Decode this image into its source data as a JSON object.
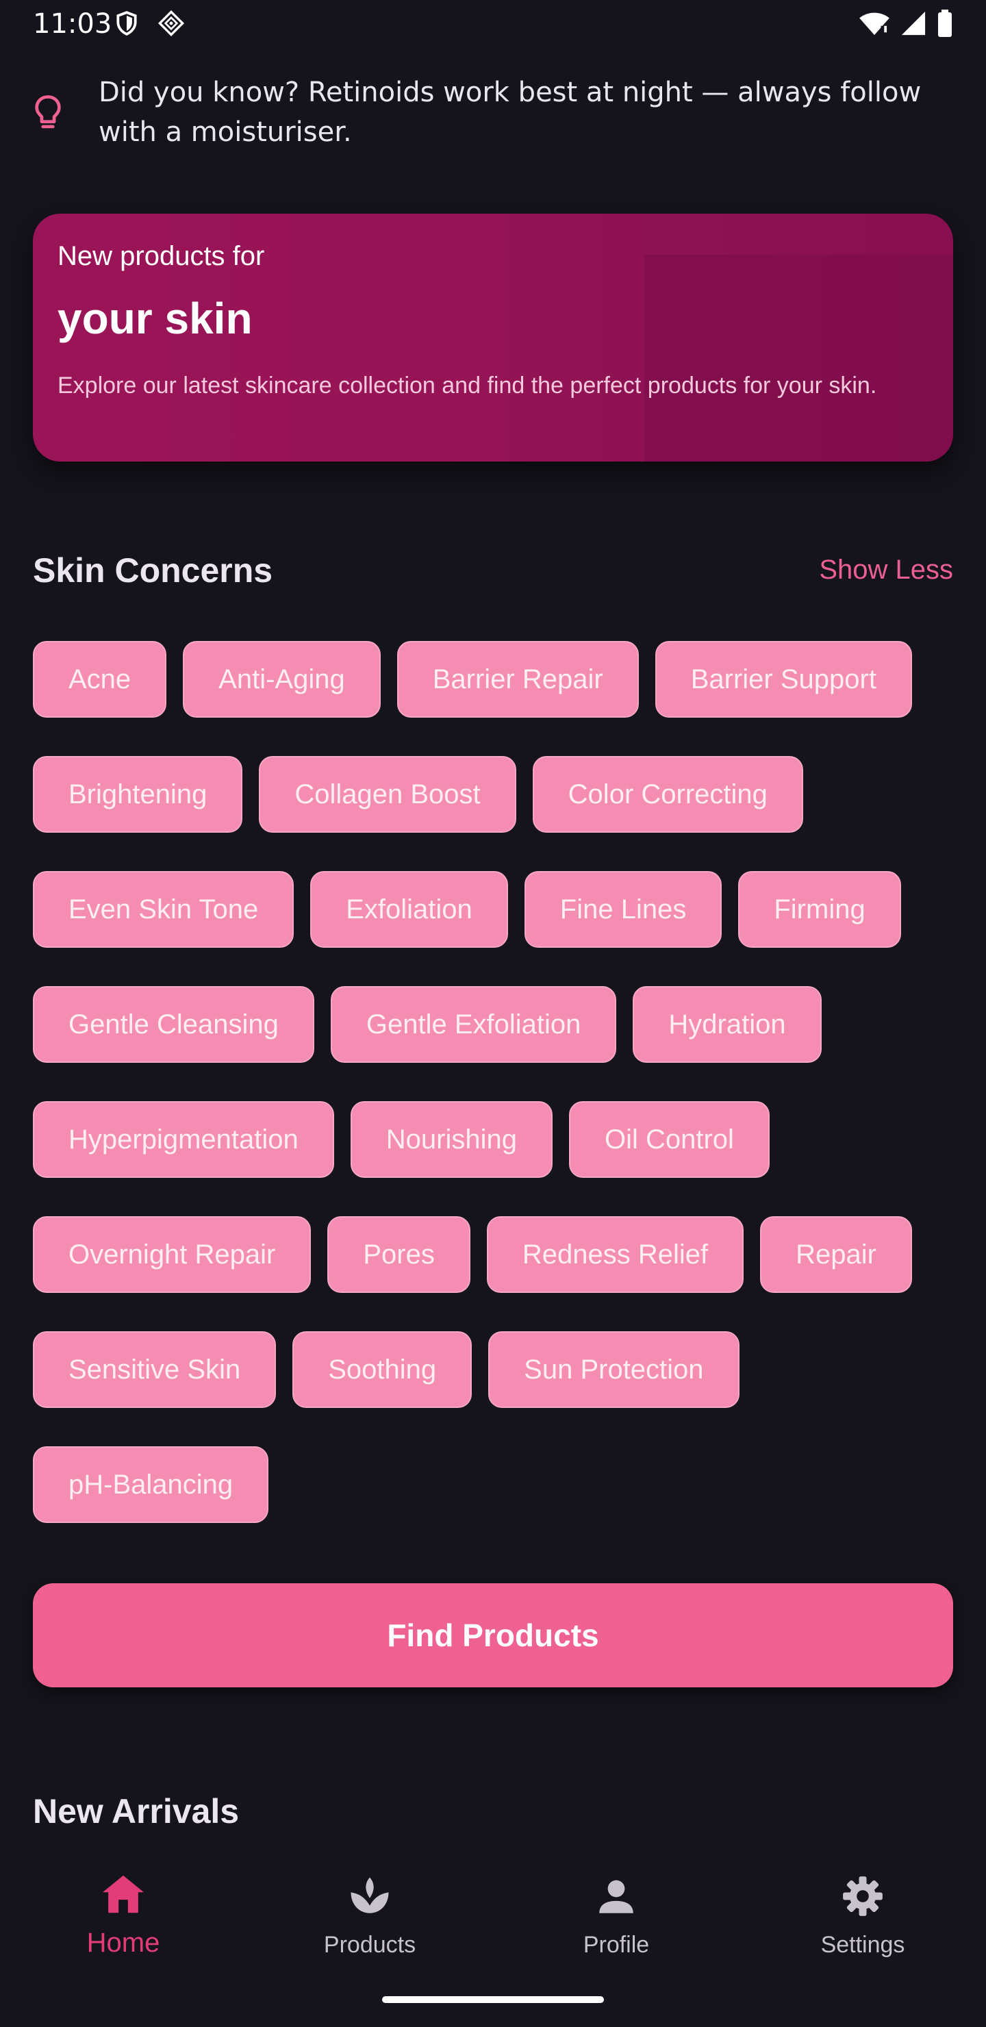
{
  "status_bar": {
    "time": "11:03",
    "icons": [
      "shield-icon",
      "diamond-icon",
      "wifi-icon",
      "signal-icon",
      "battery-icon"
    ]
  },
  "tip": {
    "icon": "lightbulb-icon",
    "text": "Did you know? Retinoids work best at night — always follow with a moisturiser."
  },
  "hero": {
    "subtitle": "New products for",
    "title": "your skin",
    "description": "Explore our latest skincare collection and find the perfect products for your skin."
  },
  "skin_concerns": {
    "title": "Skin Concerns",
    "toggle_label": "Show Less",
    "chips": [
      "Acne",
      "Anti-Aging",
      "Barrier Repair",
      "Barrier Support",
      "Brightening",
      "Collagen Boost",
      "Color Correcting",
      "Even Skin Tone",
      "Exfoliation",
      "Fine Lines",
      "Firming",
      "Gentle Cleansing",
      "Gentle Exfoliation",
      "Hydration",
      "Hyperpigmentation",
      "Nourishing",
      "Oil Control",
      "Overnight Repair",
      "Pores",
      "Redness Relief",
      "Repair",
      "Sensitive Skin",
      "Soothing",
      "Sun Protection",
      "pH-Balancing"
    ]
  },
  "find_button": {
    "label": "Find Products"
  },
  "new_arrivals": {
    "title": "New Arrivals"
  },
  "nav": {
    "items": [
      {
        "label": "Home",
        "icon": "home-icon",
        "active": true
      },
      {
        "label": "Products",
        "icon": "lotus-icon",
        "active": false
      },
      {
        "label": "Profile",
        "icon": "person-icon",
        "active": false
      },
      {
        "label": "Settings",
        "icon": "gear-icon",
        "active": false
      }
    ]
  },
  "colors": {
    "background": "#15131b",
    "accent": "#ee6190",
    "chip": "#f48db1",
    "active_nav": "#e33d78",
    "hero": "#961456"
  }
}
